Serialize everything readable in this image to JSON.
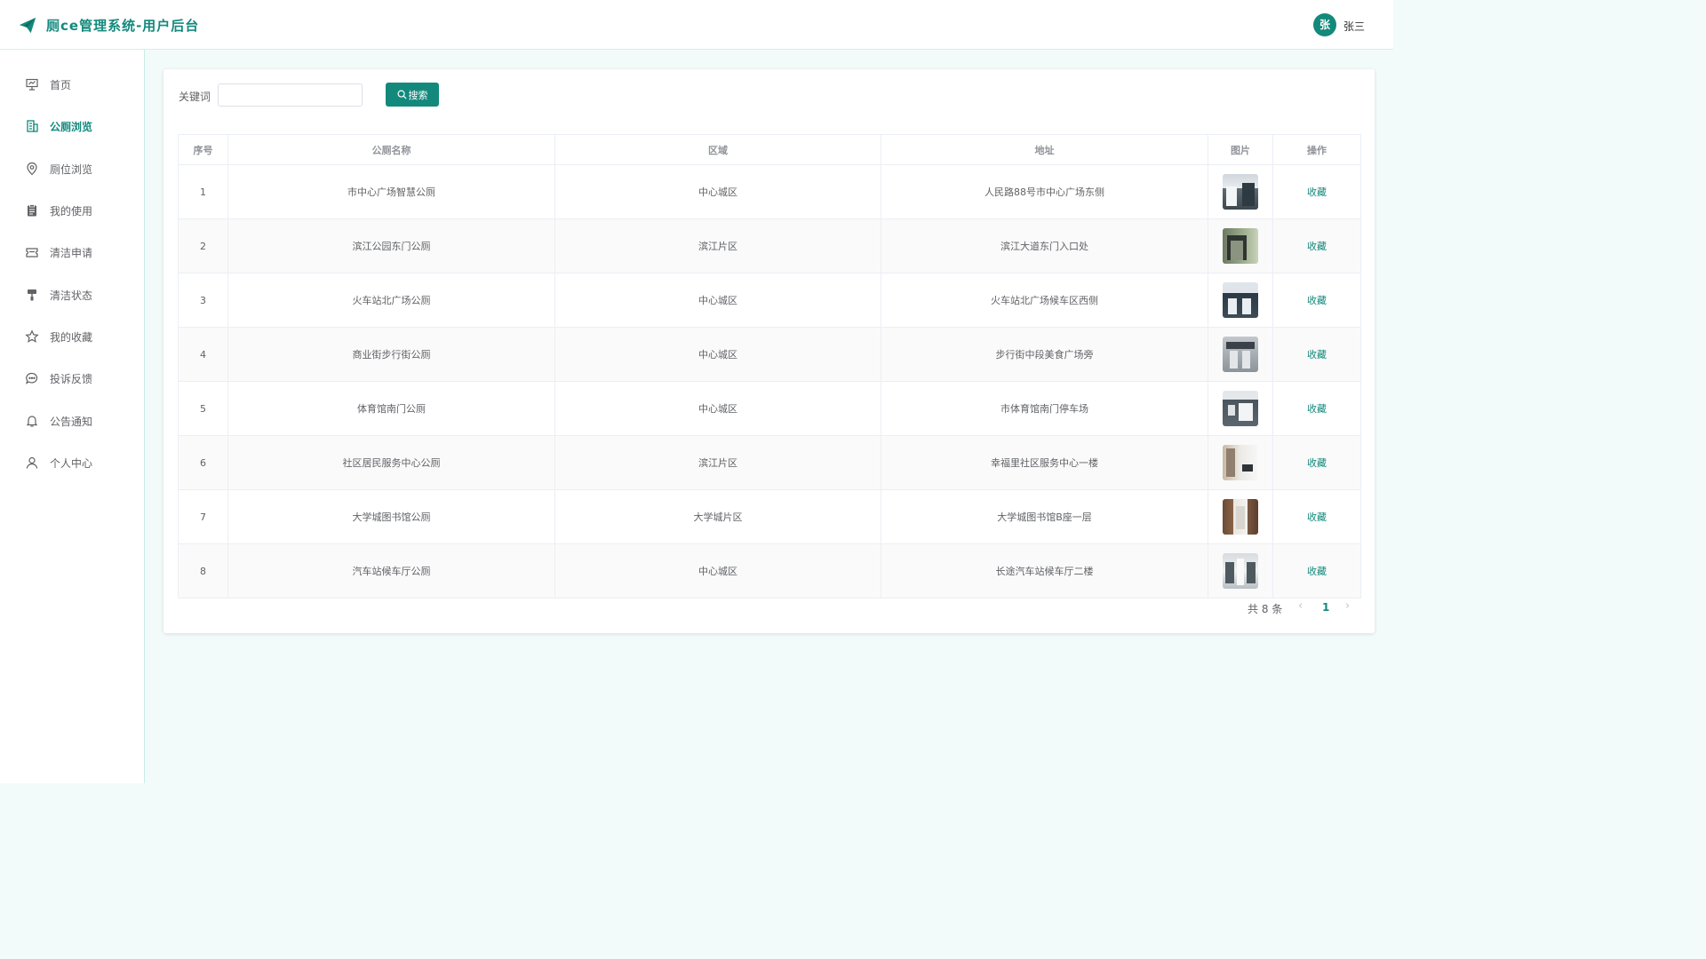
{
  "header": {
    "title": "厕ce管理系统-用户后台",
    "avatar_char": "张",
    "username": "张三",
    "accent": "#13897c"
  },
  "sidebar": {
    "items": [
      {
        "label": "首页",
        "icon": "presentation-icon",
        "active": false
      },
      {
        "label": "公厕浏览",
        "icon": "building-icon",
        "active": true
      },
      {
        "label": "厕位浏览",
        "icon": "location-pin-icon",
        "active": false
      },
      {
        "label": "我的使用",
        "icon": "clipboard-icon",
        "active": false
      },
      {
        "label": "清洁申请",
        "icon": "ticket-icon",
        "active": false
      },
      {
        "label": "清洁状态",
        "icon": "paint-roller-icon",
        "active": false
      },
      {
        "label": "我的收藏",
        "icon": "star-icon",
        "active": false
      },
      {
        "label": "投诉反馈",
        "icon": "chat-bubble-icon",
        "active": false
      },
      {
        "label": "公告通知",
        "icon": "bell-icon",
        "active": false
      },
      {
        "label": "个人中心",
        "icon": "user-icon",
        "active": false
      }
    ]
  },
  "search": {
    "label": "关键词",
    "value": "",
    "placeholder": "",
    "button": "搜索"
  },
  "table": {
    "columns": [
      "序号",
      "公厕名称",
      "区域",
      "地址",
      "图片",
      "操作"
    ],
    "rows": [
      {
        "no": "1",
        "name": "市中心广场智慧公厕",
        "area": "中心城区",
        "address": "人民路88号市中心广场东侧",
        "action": "收藏"
      },
      {
        "no": "2",
        "name": "滨江公园东门公厕",
        "area": "滨江片区",
        "address": "滨江大道东门入口处",
        "action": "收藏"
      },
      {
        "no": "3",
        "name": "火车站北广场公厕",
        "area": "中心城区",
        "address": "火车站北广场候车区西侧",
        "action": "收藏"
      },
      {
        "no": "4",
        "name": "商业街步行街公厕",
        "area": "中心城区",
        "address": "步行街中段美食广场旁",
        "action": "收藏"
      },
      {
        "no": "5",
        "name": "体育馆南门公厕",
        "area": "中心城区",
        "address": "市体育馆南门停车场",
        "action": "收藏"
      },
      {
        "no": "6",
        "name": "社区居民服务中心公厕",
        "area": "滨江片区",
        "address": "幸福里社区服务中心一楼",
        "action": "收藏"
      },
      {
        "no": "7",
        "name": "大学城图书馆公厕",
        "area": "大学城片区",
        "address": "大学城图书馆B座一层",
        "action": "收藏"
      },
      {
        "no": "8",
        "name": "汽车站候车厅公厕",
        "area": "中心城区",
        "address": "长途汽车站候车厅二楼",
        "action": "收藏"
      }
    ]
  },
  "pagination": {
    "total_text": "共 8 条",
    "current": "1",
    "prev": "‹",
    "next": "›"
  }
}
